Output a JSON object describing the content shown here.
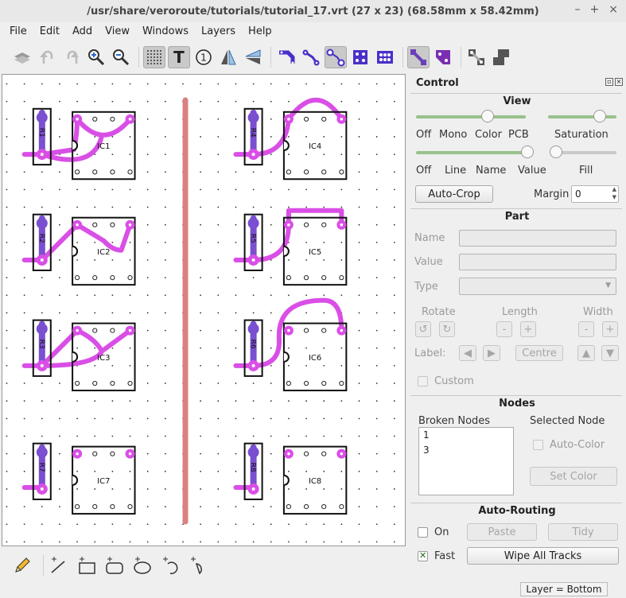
{
  "window": {
    "title": "/usr/share/veroroute/tutorials/tutorial_17.vrt    (27 x 23)    (68.58mm x 58.42mm)",
    "controls": [
      "–",
      "+",
      "×"
    ]
  },
  "menu": [
    "File",
    "Edit",
    "Add",
    "View",
    "Windows",
    "Layers",
    "Help"
  ],
  "toolbar": {
    "icons": [
      "layers-icon",
      "undo-icon",
      "redo-icon",
      "zoom-in-icon",
      "zoom-out-icon",
      "grid-icon",
      "text-icon",
      "number-icon",
      "mirror-lr-icon",
      "mirror-tb-icon",
      "track-style-1-icon",
      "track-style-2-icon",
      "track-style-3-icon",
      "pad-style-1-icon",
      "pad-style-2-icon",
      "diagonal-1-icon",
      "diagonal-2-icon",
      "diagonal-3-icon",
      "diagonal-4-icon"
    ],
    "number_glyph": "1",
    "text_glyph": "T"
  },
  "board": {
    "components": [
      {
        "ic": "IC1",
        "res": "R1"
      },
      {
        "ic": "IC2",
        "res": "R2"
      },
      {
        "ic": "IC3",
        "res": "R3"
      },
      {
        "ic": "IC4",
        "res": "R4"
      },
      {
        "ic": "IC5",
        "res": "R5"
      },
      {
        "ic": "IC6",
        "res": "R6"
      },
      {
        "ic": "IC7",
        "res": "R7"
      },
      {
        "ic": "IC8",
        "res": "R8"
      }
    ],
    "colors": {
      "track": "#d94fe6",
      "pad": "#7a4fd0",
      "cut": "#d98080"
    }
  },
  "control": {
    "title": "Control",
    "view": {
      "title": "View",
      "labels_row1": [
        "Off",
        "Mono",
        "Color",
        "PCB"
      ],
      "saturation": "Saturation",
      "labels_row2": [
        "Off",
        "Line",
        "Name",
        "Value"
      ],
      "fill": "Fill",
      "view_level": 0.65,
      "saturation_level": 0.75,
      "text_level": 1.0,
      "fill_level": 0.0,
      "autocrop": "Auto-Crop",
      "margin_label": "Margin",
      "margin_value": "0"
    },
    "part": {
      "title": "Part",
      "name_label": "Name",
      "value_label": "Value",
      "type_label": "Type",
      "rotate": "Rotate",
      "length": "Length",
      "width": "Width",
      "label": "Label:",
      "centre": "Centre",
      "custom": "Custom",
      "minus": "-",
      "plus": "+",
      "rot_ccw": "↺",
      "rot_cw": "↻",
      "left": "◀",
      "right": "▶",
      "up": "▲",
      "down": "▼"
    },
    "nodes": {
      "title": "Nodes",
      "broken": "Broken Nodes",
      "selected": "Selected Node",
      "items": [
        "1",
        "3"
      ],
      "autocolor": "Auto-Color",
      "setcolor": "Set Color"
    },
    "routing": {
      "title": "Auto-Routing",
      "on": "On",
      "paste": "Paste",
      "tidy": "Tidy",
      "fast": "Fast",
      "wipe": "Wipe All Tracks"
    }
  },
  "bottom_tools": [
    "pencil-icon",
    "add-line-icon",
    "add-rect-icon",
    "add-rounded-rect-icon",
    "add-ellipse-icon",
    "add-arc-icon",
    "add-chord-icon"
  ],
  "status": {
    "layer": "Layer = Bottom"
  }
}
